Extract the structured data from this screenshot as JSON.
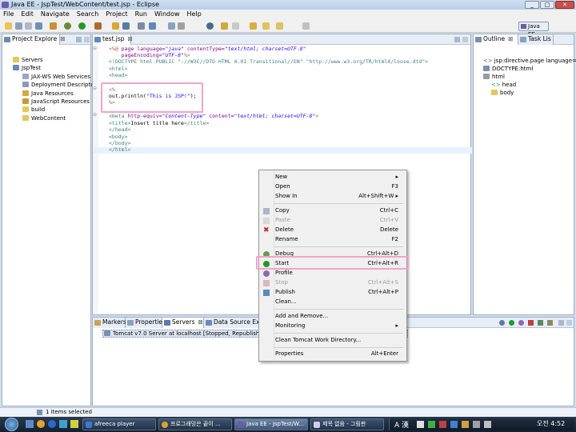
{
  "window": {
    "title": "Java EE - JspTest/WebContent/test.jsp - Eclipse",
    "buttons": [
      "_",
      "□",
      "✕"
    ]
  },
  "menu": [
    "File",
    "Edit",
    "Navigate",
    "Search",
    "Project",
    "Run",
    "Window",
    "Help"
  ],
  "perspective": "Java EE",
  "project_explorer": {
    "tab": "Project Explore",
    "items": [
      {
        "label": "Servers",
        "icon": "folder-icon",
        "depth": 1
      },
      {
        "label": "JspTest",
        "icon": "project-icon",
        "depth": 1
      },
      {
        "label": "JAX-WS Web Services",
        "icon": "webservice-icon",
        "depth": 2
      },
      {
        "label": "Deployment Descriptor:",
        "icon": "descriptor-icon",
        "depth": 2
      },
      {
        "label": "Java Resources",
        "icon": "java-resources-icon",
        "depth": 2
      },
      {
        "label": "JavaScript Resources",
        "icon": "js-resources-icon",
        "depth": 2
      },
      {
        "label": "build",
        "icon": "folder-icon",
        "depth": 2
      },
      {
        "label": "WebContent",
        "icon": "folder-icon",
        "depth": 2
      }
    ]
  },
  "editor": {
    "tab": "test.jsp",
    "lines": {
      "l1a": "<%@ ",
      "l1b": "page ",
      "l1c": "language=",
      "l1d": "\"java\" ",
      "l1e": "contentType=",
      "l1f": "\"text/html; charset=UTF-8\"",
      "l2a": "    pageEncoding=",
      "l2b": "\"UTF-8\"",
      "l2c": "%>",
      "l3": "<!DOCTYPE html PUBLIC \"-//W3C//DTD HTML 4.01 Transitional//EN\" \"http://www.w3.org/TR/html4/loose.dtd\">",
      "l4": "<html>",
      "l5": "<head>",
      "l6": "<%",
      "l7a": "out.println(",
      "l7b": "\"This is JSP!\"",
      "l7c": ");",
      "l8": "%>",
      "l9a": "<meta ",
      "l9b": "http-equiv=",
      "l9c": "\"Content-Type\" ",
      "l9d": "content=",
      "l9e": "\"text/html; charset=UTF-8\"",
      "l9f": ">",
      "l10a": "<title>",
      "l10b": "Insert title here",
      "l10c": "</title>",
      "l11": "</head>",
      "l12": "<body>",
      "l13": "</body>",
      "l14": "</html>"
    }
  },
  "outline": {
    "tabs": [
      "Outline",
      "Task Lis"
    ],
    "items": [
      {
        "label": "jsp:directive.page language=java"
      },
      {
        "label": "DOCTYPE:html"
      },
      {
        "label": "html"
      },
      {
        "label": "head"
      },
      {
        "label": "body"
      }
    ]
  },
  "bottom_tabs": [
    "Markers",
    "Properties",
    "Servers",
    "Data Source Explo"
  ],
  "server_row": "Tomcat v7.0 Server at localhost  [Stopped, Republish]",
  "context_menu": [
    {
      "label": "New",
      "shortcut": "▸",
      "disabled": false,
      "icon": ""
    },
    {
      "label": "Open",
      "shortcut": "F3",
      "disabled": false,
      "icon": ""
    },
    {
      "label": "Show In",
      "shortcut": "Alt+Shift+W ▸",
      "disabled": false,
      "icon": ""
    },
    {
      "label": "Copy",
      "shortcut": "Ctrl+C",
      "disabled": false,
      "icon": "copy-icon"
    },
    {
      "label": "Paste",
      "shortcut": "Ctrl+V",
      "disabled": true,
      "icon": "paste-icon"
    },
    {
      "label": "Delete",
      "shortcut": "Delete",
      "disabled": false,
      "icon": "delete-icon"
    },
    {
      "label": "Rename",
      "shortcut": "F2",
      "disabled": false,
      "icon": ""
    },
    {
      "label": "Debug",
      "shortcut": "Ctrl+Alt+D",
      "disabled": false,
      "icon": "debug-icon"
    },
    {
      "label": "Start",
      "shortcut": "Ctrl+Alt+R",
      "disabled": false,
      "icon": "start-icon"
    },
    {
      "label": "Profile",
      "shortcut": "",
      "disabled": false,
      "icon": "profile-icon"
    },
    {
      "label": "Stop",
      "shortcut": "Ctrl+Alt+S",
      "disabled": true,
      "icon": "stop-icon"
    },
    {
      "label": "Publish",
      "shortcut": "Ctrl+Alt+P",
      "disabled": false,
      "icon": "publish-icon"
    },
    {
      "label": "Clean...",
      "shortcut": "",
      "disabled": false,
      "icon": ""
    },
    {
      "label": "Add and Remove...",
      "shortcut": "",
      "disabled": false,
      "icon": ""
    },
    {
      "label": "Monitoring",
      "shortcut": "▸",
      "disabled": false,
      "icon": ""
    },
    {
      "label": "Clean Tomcat Work Directory...",
      "shortcut": "",
      "disabled": false,
      "icon": ""
    },
    {
      "label": "Properties",
      "shortcut": "Alt+Enter",
      "disabled": false,
      "icon": ""
    }
  ],
  "status": "1 items selected",
  "taskbar": {
    "items": [
      "afreeca player",
      "프로그래밍은 끝이 ...",
      "Java EE - JspTest/W...",
      "제목 없음 - 그림판"
    ],
    "tray": "A 漢",
    "clock": "오전 4:52"
  },
  "colors": {
    "highlight": "#f3a3c8",
    "panel_border": "#9eb0c8",
    "start_icon": "#1f9a2b",
    "delete_icon": "#cc2222"
  }
}
